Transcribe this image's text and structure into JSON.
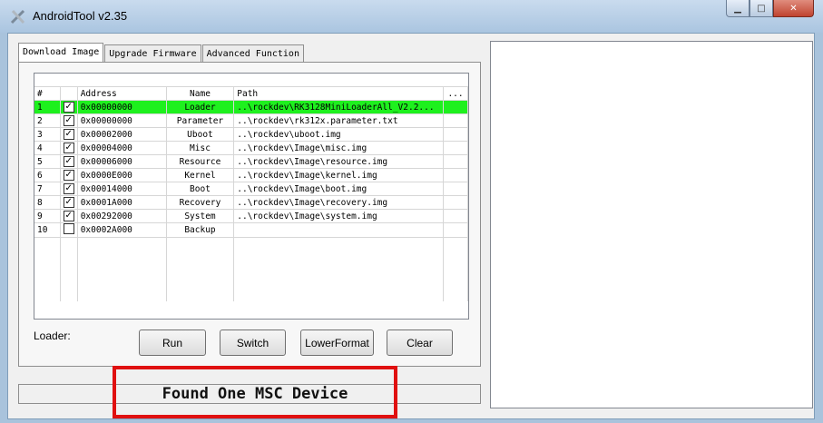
{
  "window": {
    "title": "AndroidTool v2.35"
  },
  "tabs": [
    {
      "label": "Download Image",
      "active": true
    },
    {
      "label": "Upgrade Firmware",
      "active": false
    },
    {
      "label": "Advanced Function",
      "active": false
    }
  ],
  "table": {
    "headers": [
      "#",
      "",
      "Address",
      "Name",
      "Path",
      "..."
    ],
    "rows": [
      {
        "num": "1",
        "checked": true,
        "address": "0x00000000",
        "name": "Loader",
        "path": "..\\rockdev\\RK3128MiniLoaderAll_V2.2...",
        "highlight": true
      },
      {
        "num": "2",
        "checked": true,
        "address": "0x00000000",
        "name": "Parameter",
        "path": "..\\rockdev\\rk312x.parameter.txt",
        "highlight": false
      },
      {
        "num": "3",
        "checked": true,
        "address": "0x00002000",
        "name": "Uboot",
        "path": "..\\rockdev\\uboot.img",
        "highlight": false
      },
      {
        "num": "4",
        "checked": true,
        "address": "0x00004000",
        "name": "Misc",
        "path": "..\\rockdev\\Image\\misc.img",
        "highlight": false
      },
      {
        "num": "5",
        "checked": true,
        "address": "0x00006000",
        "name": "Resource",
        "path": "..\\rockdev\\Image\\resource.img",
        "highlight": false
      },
      {
        "num": "6",
        "checked": true,
        "address": "0x0000E000",
        "name": "Kernel",
        "path": "..\\rockdev\\Image\\kernel.img",
        "highlight": false
      },
      {
        "num": "7",
        "checked": true,
        "address": "0x00014000",
        "name": "Boot",
        "path": "..\\rockdev\\Image\\boot.img",
        "highlight": false
      },
      {
        "num": "8",
        "checked": true,
        "address": "0x0001A000",
        "name": "Recovery",
        "path": "..\\rockdev\\Image\\recovery.img",
        "highlight": false
      },
      {
        "num": "9",
        "checked": true,
        "address": "0x00292000",
        "name": "System",
        "path": "..\\rockdev\\Image\\system.img",
        "highlight": false
      },
      {
        "num": "10",
        "checked": false,
        "address": "0x0002A000",
        "name": "Backup",
        "path": "",
        "highlight": false
      }
    ]
  },
  "loader_label": "Loader:",
  "buttons": {
    "run": "Run",
    "switch": "Switch",
    "lower_format": "LowerFormat",
    "clear": "Clear"
  },
  "status": {
    "text": "Found One MSC Device"
  },
  "colors": {
    "highlight_row": "#1ef01e",
    "annotation_box": "#e01010"
  }
}
